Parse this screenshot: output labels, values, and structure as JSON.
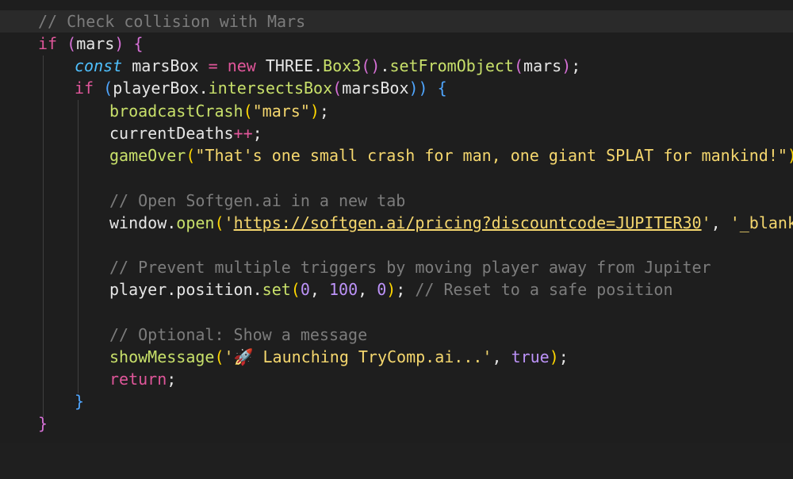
{
  "editor": {
    "lines": {
      "l1": {
        "comment": "// Check collision with Mars"
      },
      "l2": {
        "kw": "if",
        "open": " (",
        "var": "mars",
        "close": ") ",
        "brace": "{"
      },
      "l3": {
        "storage": "const",
        "var1": "marsBox",
        "eq": " = ",
        "kw": "new",
        "cls": "THREE",
        "dot": ".",
        "fn1": "Box3",
        "p1": "()",
        "dot2": ".",
        "fn2": "setFromObject",
        "p2o": "(",
        "arg": "mars",
        "p2c": ")",
        "semi": ";"
      },
      "l4": {
        "kw": "if",
        "p1o": " (",
        "var": "playerBox",
        "dot": ".",
        "fn": "intersectsBox",
        "p2o": "(",
        "arg": "marsBox",
        "p2c": "))",
        "brace": " {"
      },
      "l5": {
        "fn": "broadcastCrash",
        "po": "(",
        "str": "\"mars\"",
        "pc": ")",
        "semi": ";"
      },
      "l6": {
        "var": "currentDeaths",
        "op": "++",
        "semi": ";"
      },
      "l7": {
        "fn": "gameOver",
        "po": "(",
        "str": "\"That's one small crash for man, one giant SPLAT for mankind!\"",
        "pc": ")",
        "semi": ";"
      },
      "l9": {
        "comment": "// Open Softgen.ai in a new tab"
      },
      "l10": {
        "var": "window",
        "dot": ".",
        "fn": "open",
        "po": "(",
        "q1": "'",
        "url": "https://softgen.ai/pricing?discountcode=JUPITER30",
        "q2": "'",
        "comma": ", ",
        "str2": "'_blank'",
        "pc": ")",
        "semi": ";"
      },
      "l12": {
        "comment": "// Prevent multiple triggers by moving player away from Jupiter"
      },
      "l13": {
        "var": "player",
        "dot": ".",
        "prop": "position",
        "dot2": ".",
        "fn": "set",
        "po": "(",
        "n1": "0",
        "c1": ", ",
        "n2": "100",
        "c2": ", ",
        "n3": "0",
        "pc": ")",
        "semi": ";",
        "comment": " // Reset to a safe position"
      },
      "l15": {
        "comment": "// Optional: Show a message"
      },
      "l16": {
        "fn": "showMessage",
        "po": "(",
        "str": "'🚀 Launching TryComp.ai...'",
        "comma": ", ",
        "bool": "true",
        "pc": ")",
        "semi": ";"
      },
      "l17": {
        "kw": "return",
        "semi": ";"
      },
      "l18": {
        "brace": "}"
      },
      "l19": {
        "brace": "}"
      }
    }
  }
}
